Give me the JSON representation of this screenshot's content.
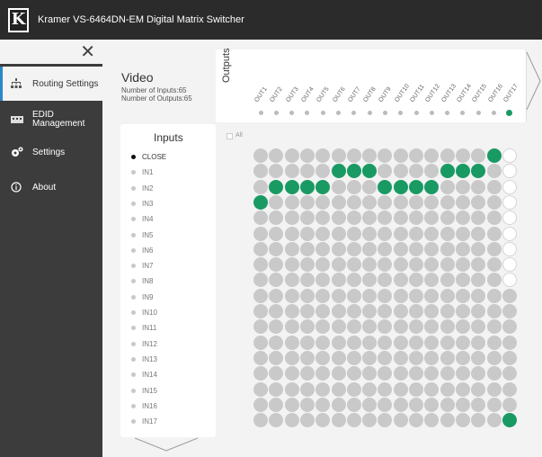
{
  "header": {
    "title": "Kramer  VS-6464DN-EM Digital Matrix Switcher",
    "logo_letter": "K"
  },
  "sidebar": {
    "close_glyph": "✕",
    "items": [
      {
        "label": "Routing Settings",
        "icon": "routing-icon",
        "active": true
      },
      {
        "label": "EDID Management",
        "line1": "EDID",
        "line2": "Management",
        "icon": "edid-icon",
        "active": false
      },
      {
        "label": "Settings",
        "icon": "gears-icon",
        "active": false
      },
      {
        "label": "About",
        "icon": "info-icon",
        "active": false
      }
    ]
  },
  "video": {
    "title": "Video",
    "inputs_line": "Number of Inputs:65",
    "outputs_line": "Number of Outputs:65"
  },
  "outputs": {
    "label": "Outputs",
    "items": [
      "OUT1",
      "OUT2",
      "OUT3",
      "OUT4",
      "OUT5",
      "OUT6",
      "OUT7",
      "OUT8",
      "OUT9",
      "OUT10",
      "OUT11",
      "OUT12",
      "OUT13",
      "OUT14",
      "OUT15",
      "OUT16",
      "OUT17"
    ],
    "selected_index": 16
  },
  "select_all": {
    "label": "All"
  },
  "inputs": {
    "title": "Inputs",
    "items": [
      "CLOSE",
      "IN1",
      "IN2",
      "IN3",
      "IN4",
      "IN5",
      "IN6",
      "IN7",
      "IN8",
      "IN9",
      "IN10",
      "IN11",
      "IN12",
      "IN13",
      "IN14",
      "IN15",
      "IN16",
      "IN17"
    ],
    "selected_index": 0
  },
  "matrix": {
    "rows": 18,
    "cols": 17,
    "on_cells": [
      [
        0,
        15
      ],
      [
        1,
        5
      ],
      [
        1,
        6
      ],
      [
        1,
        7
      ],
      [
        1,
        12
      ],
      [
        1,
        13
      ],
      [
        1,
        14
      ],
      [
        2,
        1
      ],
      [
        2,
        2
      ],
      [
        2,
        3
      ],
      [
        2,
        4
      ],
      [
        2,
        8
      ],
      [
        2,
        9
      ],
      [
        2,
        10
      ],
      [
        2,
        11
      ],
      [
        3,
        0
      ],
      [
        17,
        16
      ]
    ],
    "white_cells": [
      [
        0,
        16
      ],
      [
        1,
        16
      ],
      [
        2,
        16
      ],
      [
        3,
        16
      ],
      [
        4,
        16
      ],
      [
        5,
        16
      ],
      [
        6,
        16
      ],
      [
        7,
        16
      ],
      [
        8,
        16
      ]
    ]
  },
  "colors": {
    "accent": "#1a9a63",
    "sidebar": "#3c3c3c",
    "topbar": "#2b2b2b",
    "active_border": "#2a88c8"
  }
}
